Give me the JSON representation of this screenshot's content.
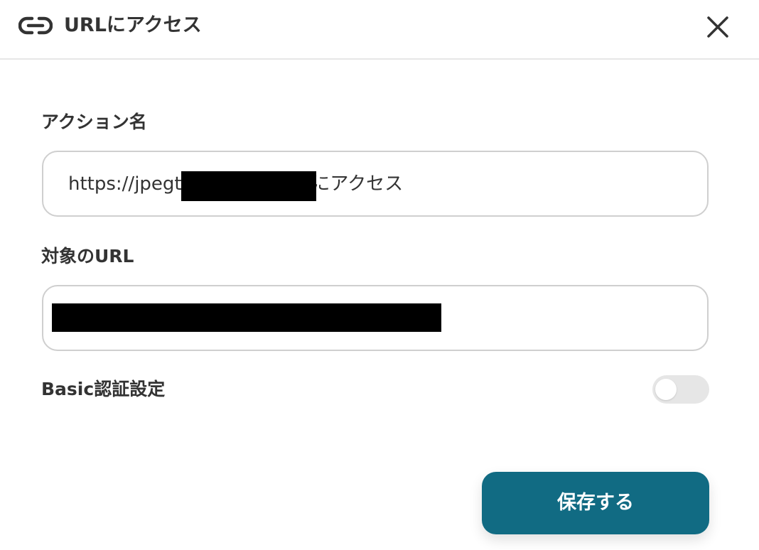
{
  "header": {
    "icon": "link-icon",
    "title": "URLにアクセス",
    "close_icon": "close-icon"
  },
  "form": {
    "action_name": {
      "label": "アクション名",
      "value_prefix": "https://jpegt",
      "value_suffix": "/にアクセス"
    },
    "target_url": {
      "label": "対象のURL",
      "value": ""
    },
    "basic_auth": {
      "label": "Basic認証設定",
      "enabled": false
    }
  },
  "footer": {
    "save_label": "保存する",
    "save_color": "#116b83"
  }
}
